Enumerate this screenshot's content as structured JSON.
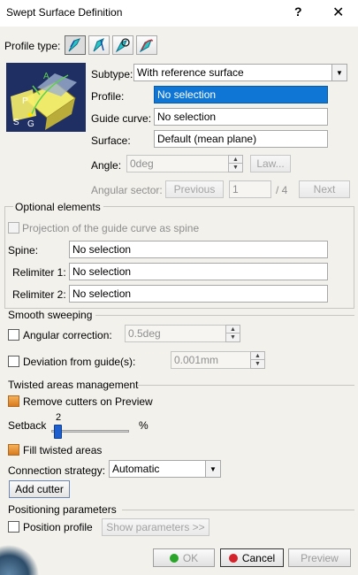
{
  "window": {
    "title": "Swept Surface Definition",
    "help_label": "?",
    "close_label": "✕"
  },
  "profile_type": {
    "label": "Profile type:",
    "icons": [
      "explicit-profile-icon",
      "line-profile-icon",
      "circle-profile-icon",
      "conic-profile-icon"
    ]
  },
  "subtype": {
    "label": "Subtype:",
    "value": "With reference surface"
  },
  "profile": {
    "label": "Profile:",
    "value": "No selection"
  },
  "guide_curve": {
    "label": "Guide curve:",
    "value": "No selection"
  },
  "surface": {
    "label": "Surface:",
    "value": "Default (mean plane)"
  },
  "angle": {
    "label": "Angle:",
    "value": "0deg",
    "law_label": "Law..."
  },
  "angular_sector": {
    "label": "Angular sector:",
    "previous_label": "Previous",
    "value": "1",
    "total": "/ 4",
    "next_label": "Next"
  },
  "optional": {
    "title": "Optional elements",
    "projection_label": "Projection of the guide curve as spine",
    "spine": {
      "label": "Spine:",
      "value": "No selection"
    },
    "relimiter1": {
      "label": "Relimiter 1:",
      "value": "No selection"
    },
    "relimiter2": {
      "label": "Relimiter 2:",
      "value": "No selection"
    }
  },
  "smooth": {
    "title": "Smooth sweeping",
    "angular_correction": {
      "label": "Angular correction:",
      "value": "0.5deg"
    },
    "deviation": {
      "label": "Deviation from guide(s):",
      "value": "0.001mm"
    }
  },
  "twisted": {
    "title": "Twisted areas management",
    "remove_cutters_label": "Remove cutters on Preview",
    "setback_label": "Setback",
    "setback_value": "2",
    "setback_unit": "%",
    "fill_label": "Fill twisted areas",
    "connection_label": "Connection strategy:",
    "connection_value": "Automatic",
    "add_cutter_label": "Add cutter"
  },
  "positioning": {
    "title": "Positioning parameters",
    "position_label": "Position profile",
    "show_params_label": "Show parameters >>"
  },
  "footer": {
    "ok_label": "OK",
    "cancel_label": "Cancel",
    "preview_label": "Preview"
  },
  "colors": {
    "selection": "#0f76d6",
    "accent_orange": "#d87a1e",
    "ok_green": "#2aa52a",
    "cancel_red": "#d4232a"
  }
}
